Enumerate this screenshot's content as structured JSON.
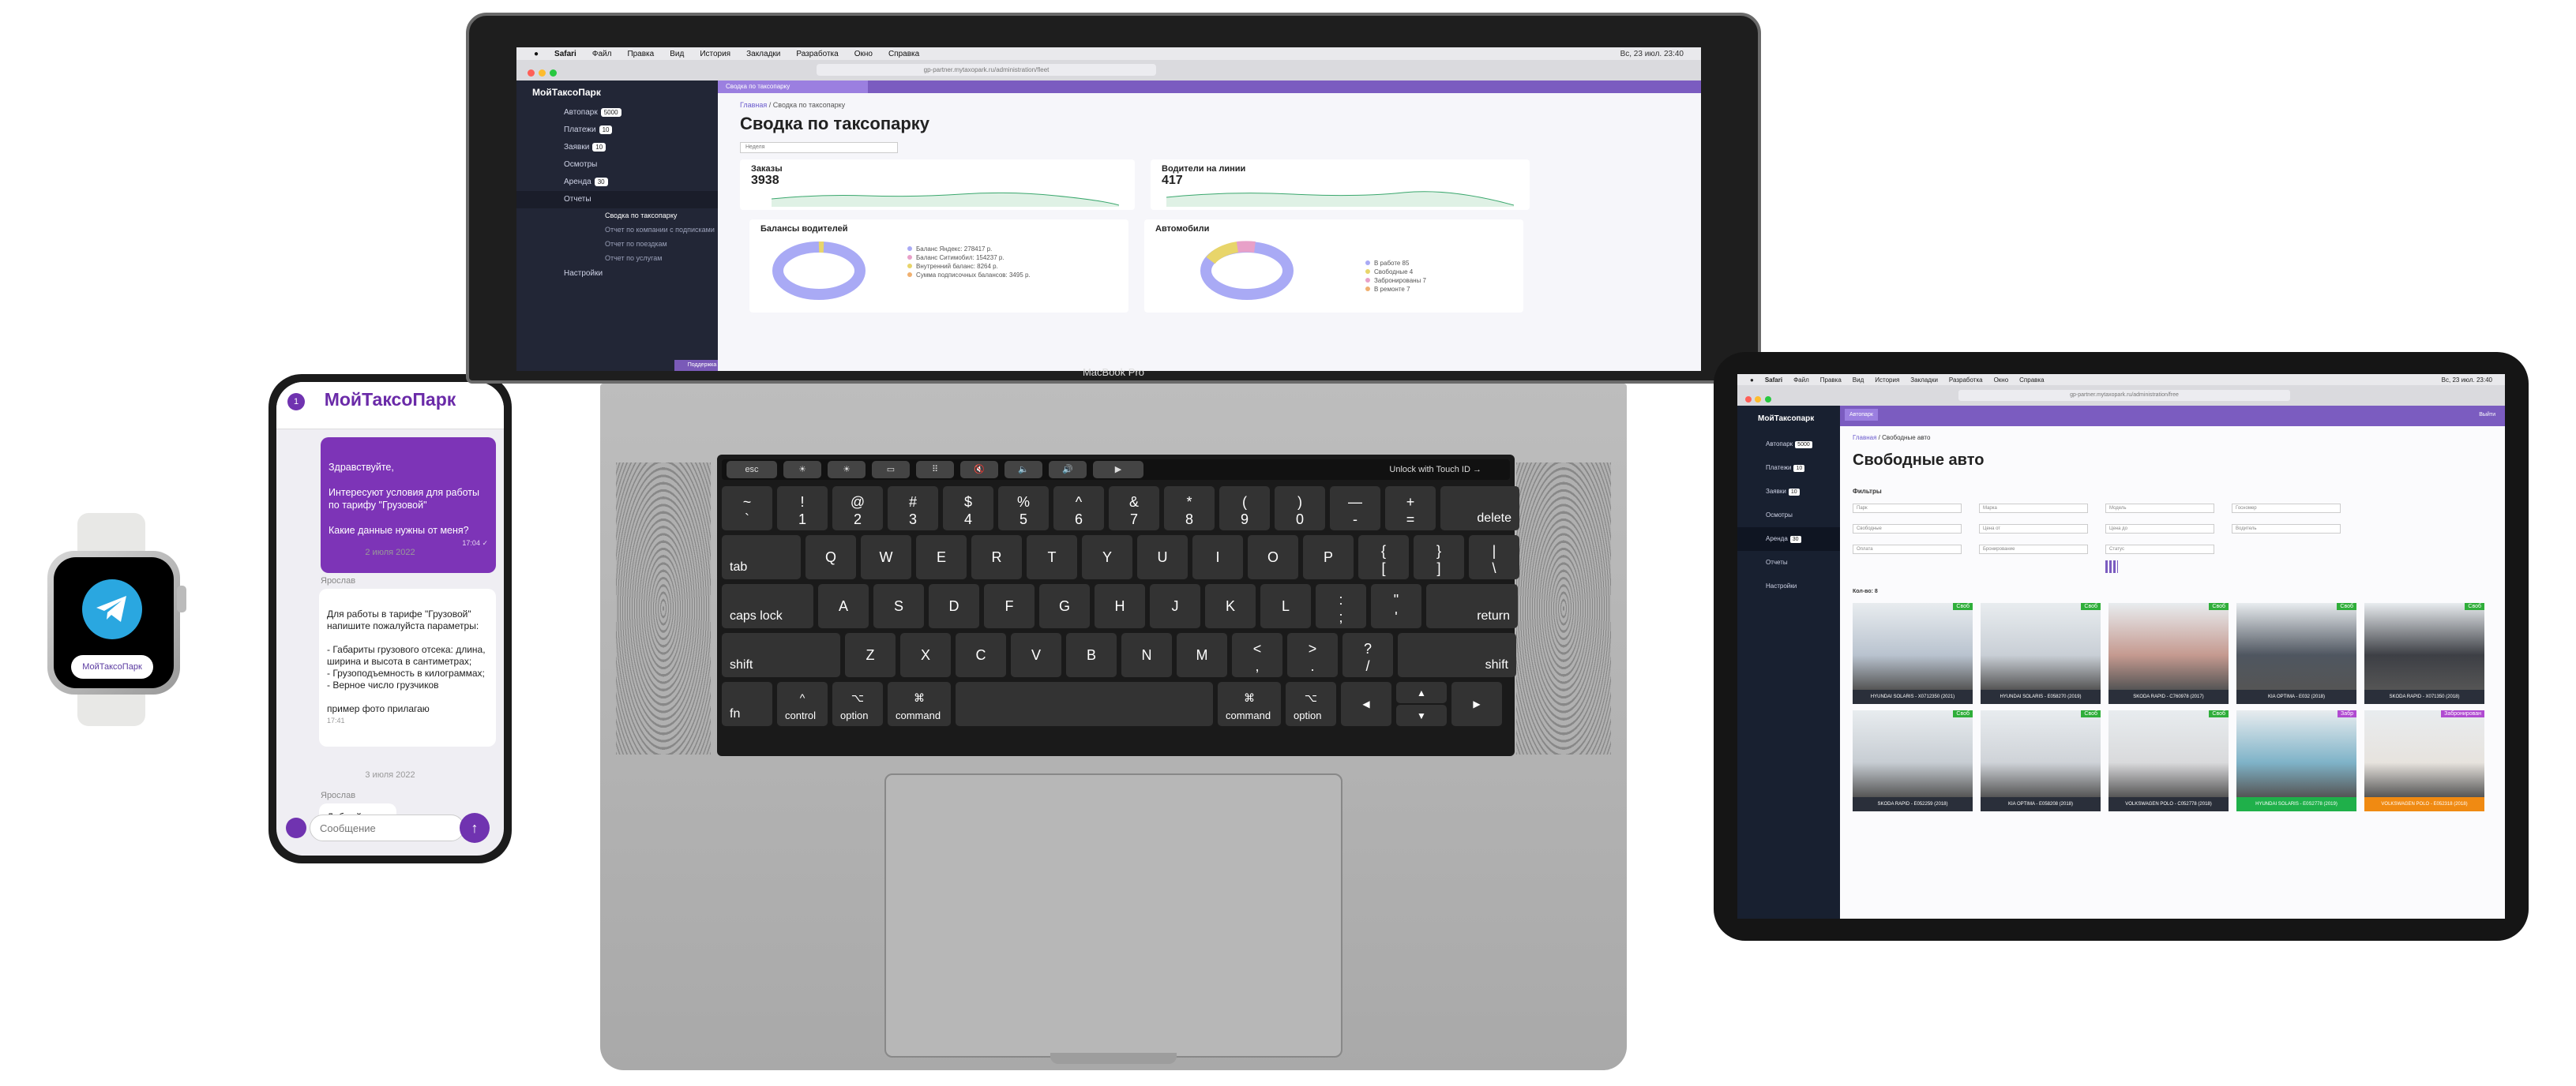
{
  "watch": {
    "button_label": "МойТаксоПарк"
  },
  "phone": {
    "brand": "МойТаксоПарк",
    "badge": "1",
    "msg_out": "Здравствуйте,\n\nИнтересуют условия для работы по тарифу \"Грузовой\"\n\nКакие данные нужны от меня?",
    "msg_out_time": "17:04 ✓",
    "date1": "2 июля 2022",
    "sender1": "Ярослав",
    "msg_in": "Для работы в тарифе \"Грузовой\" напишите пожалуйста параметры:\n\n- Габариты грузового отсека: длина, ширина и высота в сантиметрах;\n- Грузоподъемность в килограммах;\n- Верное число грузчиков\n\nпример фото прилагаю",
    "msg_in_time": "17:41",
    "date2": "3 июля 2022",
    "sender2": "Ярослав",
    "msg_last": "Добрый день",
    "input_placeholder": "Сообщение"
  },
  "laptop": {
    "menubar": [
      "Safari",
      "Файл",
      "Правка",
      "Вид",
      "История",
      "Закладки",
      "Разработка",
      "Окно",
      "Справка"
    ],
    "clock": "Вс, 23 июл. 23:40",
    "url": "gp-partner.mytaxopark.ru/administration/fleet",
    "logo": "МойТаксоПарк",
    "sidebar": [
      {
        "label": "Автопарк",
        "badge": "5000"
      },
      {
        "label": "Платежи",
        "badge": "10"
      },
      {
        "label": "Заявки",
        "badge": "10"
      },
      {
        "label": "Осмотры",
        "badge": ""
      },
      {
        "label": "Аренда",
        "badge": "30"
      },
      {
        "label": "Отчеты",
        "badge": ""
      }
    ],
    "sub_items": [
      "Сводка по таксопарку",
      "Отчет по компании с подписками",
      "Отчет по поездкам",
      "Отчет по услугам"
    ],
    "settings": "Настройки",
    "footer_btn": "Поддержка",
    "tab": "Сводка по таксопарку",
    "breadcrumb_home": "Главная",
    "breadcrumb_current": "Сводка по таксопарку",
    "title": "Сводка по таксопарку",
    "period": "Неделя",
    "orders_title": "Заказы",
    "orders_value": "3938",
    "drivers_title": "Водители на линии",
    "drivers_value": "417",
    "balances_title": "Балансы водителей",
    "balances_legend": [
      "Баланс Яндекс: 278417 р.",
      "Баланс Ситимобил: 154237 р.",
      "Внутренний баланс: 8264 р.",
      "Сумма подписочных балансов: 3495 р."
    ],
    "cars_title": "Автомобили",
    "cars_legend": [
      "В работе 85",
      "Свободные 4",
      "Забронированы 7",
      "В ремонте 7"
    ],
    "model": "MacBook Pro"
  },
  "keyboard": {
    "touchbar": [
      "esc",
      "☀",
      "☀",
      "▭",
      "⠿",
      "🔇",
      "🔈",
      "🔊",
      "▶"
    ],
    "touch_id": "Unlock with Touch ID →",
    "row1": [
      [
        "~",
        "`"
      ],
      [
        "!",
        "1"
      ],
      [
        "@",
        "2"
      ],
      [
        "#",
        "3"
      ],
      [
        "$",
        "4"
      ],
      [
        "%",
        "5"
      ],
      [
        "^",
        "6"
      ],
      [
        "&",
        "7"
      ],
      [
        "*",
        "8"
      ],
      [
        "(",
        "9"
      ],
      [
        ")",
        "0"
      ],
      [
        "—",
        "-"
      ],
      [
        "+",
        "="
      ]
    ],
    "delete": "delete",
    "tab": "tab",
    "row2": [
      "Q",
      "W",
      "E",
      "R",
      "T",
      "Y",
      "U",
      "I",
      "O",
      "P"
    ],
    "row2_sym": [
      [
        "{",
        "["
      ],
      [
        "}",
        "]"
      ],
      [
        "|",
        "\\"
      ]
    ],
    "caps": "caps lock",
    "row3": [
      "A",
      "S",
      "D",
      "F",
      "G",
      "H",
      "J",
      "K",
      "L"
    ],
    "row3_sym": [
      [
        ":",
        ";"
      ],
      [
        "\"",
        "'"
      ]
    ],
    "return": "return",
    "shift": "shift",
    "row4": [
      "Z",
      "X",
      "C",
      "V",
      "B",
      "N",
      "M"
    ],
    "row4_sym": [
      [
        "<",
        ","
      ],
      [
        ">",
        "."
      ],
      [
        "?",
        "/"
      ]
    ],
    "fn": "fn",
    "control": "control",
    "option": "option",
    "command": "command",
    "control_sym": "^",
    "option_sym": "⌥",
    "command_sym": "⌘",
    "arrow_left": "◀",
    "arrow_up": "▲",
    "arrow_down": "▼",
    "arrow_right": "▶"
  },
  "tablet": {
    "menubar": [
      "Safari",
      "Файл",
      "Правка",
      "Вид",
      "История",
      "Закладки",
      "Разработка",
      "Окно",
      "Справка"
    ],
    "clock": "Вс, 23 июл. 23:40",
    "url": "gp-partner.mytaxopark.ru/administration/free",
    "logo": "МойТаксопарк",
    "sidebar": [
      {
        "label": "Автопарк",
        "badge": "5000"
      },
      {
        "label": "Платежи",
        "badge": "10"
      },
      {
        "label": "Заявки",
        "badge": "10"
      },
      {
        "label": "Осмотры",
        "badge": ""
      },
      {
        "label": "Аренда",
        "badge": "30"
      },
      {
        "label": "Отчеты",
        "badge": ""
      },
      {
        "label": "Настройки",
        "badge": ""
      }
    ],
    "tab": "Автопарк",
    "exit": "Выйти",
    "breadcrumb_home": "Главная",
    "breadcrumb_current": "Свободные авто",
    "title": "Свободные авто",
    "filters_label": "Фильтры",
    "filters": [
      "Парк",
      "Марка",
      "Модель",
      "Госномер",
      "Свободные",
      "Цена от",
      "Цена до",
      "Водитель",
      "Оплата",
      "Бронирование",
      "Статус"
    ],
    "count": "Кол-во: 8",
    "cars": [
      {
        "cap": "HYUNDAI SOLARIS - X0712350 (2021)",
        "tag": "Своб",
        "img": "#b9c3cf",
        "cap_bg": "#2a2f3a",
        "tag_bg": "#2fae3a"
      },
      {
        "cap": "HYUNDAI SOLARIS - E058270 (2019)",
        "tag": "Своб",
        "img": "#c9cfd6",
        "cap_bg": "#2a2f3a",
        "tag_bg": "#2fae3a"
      },
      {
        "cap": "SKODA RAPID - C760978 (2017)",
        "tag": "Своб",
        "img": "#c59a90",
        "cap_bg": "#2a2f3a",
        "tag_bg": "#2fae3a"
      },
      {
        "cap": "KIA OPTIMA - E032 (2018)",
        "tag": "Своб",
        "img": "#4f5660",
        "cap_bg": "#2a2f3a",
        "tag_bg": "#2fae3a"
      },
      {
        "cap": "SKODA RAPID - X071350 (2018)",
        "tag": "Своб",
        "img": "#3d3f45",
        "cap_bg": "#2a2f3a",
        "tag_bg": "#2fae3a"
      },
      {
        "cap": "SKODA RAPID - E052259 (2018)",
        "tag": "Своб",
        "img": "#c7cdd3",
        "cap_bg": "#2a2f3a",
        "tag_bg": "#2fae3a"
      },
      {
        "cap": "KIA OPTIMA - E058208 (2018)",
        "tag": "Своб",
        "img": "#cfd3d8",
        "cap_bg": "#2a2f3a",
        "tag_bg": "#2fae3a"
      },
      {
        "cap": "VOLKSWAGEN POLO - C052778 (2018)",
        "tag": "Своб",
        "img": "#d9dadc",
        "cap_bg": "#2a2f3a",
        "tag_bg": "#2fae3a"
      },
      {
        "cap": "HYUNDAI SOLARIS - E0S2778 (2019)",
        "tag": "Забр",
        "img": "#7fb3c8",
        "cap_bg": "#1fb04a",
        "tag_bg": "#b04ad1"
      },
      {
        "cap": "VOLKSWAGEN POLO - E052318 (2018)",
        "tag": "Забронирован",
        "img": "#e7e3de",
        "cap_bg": "#f08a12",
        "tag_bg": "#b04ad1"
      }
    ]
  }
}
